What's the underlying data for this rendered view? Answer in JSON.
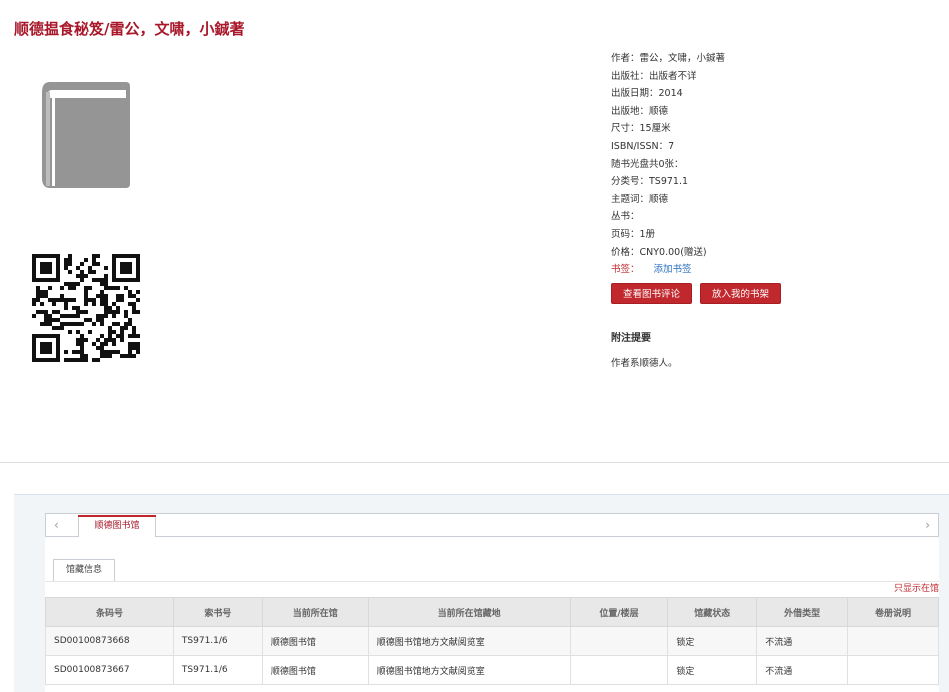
{
  "title": "顺德揾食秘笈/雷公，文啸，小鋮著",
  "meta": {
    "author": "作者：雷公，文啸，小鋮著",
    "publisher": "出版社：出版者不详",
    "pub_date": "出版日期：2014",
    "pub_place": "出版地：顺德",
    "size": "尺寸：15厘米",
    "isbn": "ISBN/ISSN：7",
    "cd": "随书光盘共0张：",
    "class_no": "分类号：TS971.1",
    "subject": "主题词：顺德",
    "series": "丛书：",
    "pages": "页码：1册",
    "price": "价格：CNY0.00(赠送)",
    "bookmark_label": "书签：",
    "bookmark_link": "添加书签"
  },
  "buttons": {
    "review": "查看图书评论",
    "shelf": "放入我的书架"
  },
  "notes": {
    "heading": "附注提要",
    "body": "作者系顺德人。"
  },
  "holdings": {
    "library_tab": "顺德图书馆",
    "info_tab": "馆藏信息",
    "only_show": "只显示在馆",
    "arrow_left": "‹",
    "arrow_right": "›",
    "columns": [
      "条码号",
      "索书号",
      "当前所在馆",
      "当前所在馆藏地",
      "位置/楼层",
      "馆藏状态",
      "外借类型",
      "卷册说明"
    ],
    "rows": [
      [
        "SD00100873668",
        "TS971.1/6",
        "顺德图书馆",
        "顺德图书馆地方文献阅览室",
        "",
        "锁定",
        "不流通",
        ""
      ],
      [
        "SD00100873667",
        "TS971.1/6",
        "顺德图书馆",
        "顺德图书馆地方文献阅览室",
        "",
        "锁定",
        "不流通",
        ""
      ]
    ]
  },
  "colors": {
    "accent": "#c0282e",
    "title": "#a8182a",
    "link": "#2a6ebb",
    "book_icon": "#959595"
  },
  "icons": {
    "cover": "book-icon",
    "qr": "qr-code"
  }
}
